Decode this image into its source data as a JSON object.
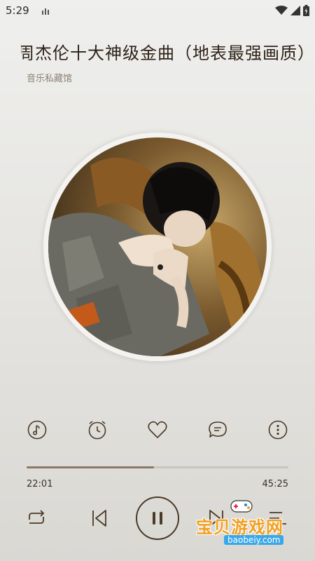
{
  "status_bar": {
    "time": "5:29"
  },
  "song": {
    "title": "周杰伦十大神级金曲（地表最强画质）",
    "artist": "音乐私藏馆"
  },
  "player": {
    "current_time": "22:01",
    "total_time": "45:25",
    "progress": 0.487
  },
  "actions": [
    {
      "icon": "music-note-icon"
    },
    {
      "icon": "alarm-clock-icon"
    },
    {
      "icon": "heart-icon"
    },
    {
      "icon": "comment-icon"
    },
    {
      "icon": "more-icon"
    }
  ],
  "controls": [
    "repeat-icon",
    "previous-icon",
    "pause-icon",
    "next-icon",
    "playlist-icon"
  ],
  "watermark": {
    "text": "宝贝游戏网",
    "url": "baobeiy.com"
  },
  "colors": {
    "accent": "#4a3a28",
    "progress_fill": "#8a7a68",
    "track": "#c9c6c0"
  }
}
